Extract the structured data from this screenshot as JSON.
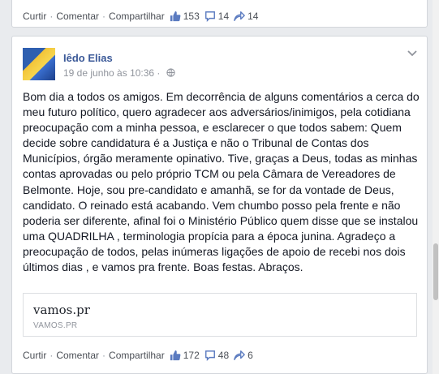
{
  "top_post": {
    "actions": {
      "curtir": "Curtir",
      "comentar": "Comentar",
      "compartilhar": "Compartilhar"
    },
    "counts": {
      "likes": "153",
      "comments": "14",
      "shares": "14"
    }
  },
  "post": {
    "author": "Iêdo Elias",
    "timestamp": "19 de junho às 10:36 ·",
    "body": "Bom dia a todos os amigos. Em decorrência de alguns comentários a cerca do meu futuro político, quero agradecer aos adversários/inimigos, pela cotidiana preocupação com a minha pessoa, e esclarecer o que todos sabem: Quem decide sobre candidatura é a Justiça e não o Tribunal de Contas dos Municípios, órgão meramente opinativo. Tive, graças a Deus, todas as minhas contas aprovadas ou pelo próprio TCM ou pela Câmara de Vereadores de Belmonte. Hoje, sou pre-candidato e amanhã, se for da vontade de Deus, candidato. O reinado está acabando. Vem chumbo posso pela frente e não poderia ser diferente, afinal foi o Ministério Público quem disse que se instalou uma QUADRILHA , terminologia propícia para a época junina. Agradeço a preocupação de todos, pelas inúmeras ligações de apoio de recebi nos dois últimos dias , e vamos pra frente. Boas festas. Abraços.",
    "link": {
      "title": "vamos.pr",
      "domain": "VAMOS.PR"
    },
    "actions": {
      "curtir": "Curtir",
      "comentar": "Comentar",
      "compartilhar": "Compartilhar"
    },
    "counts": {
      "likes": "172",
      "comments": "48",
      "shares": "6"
    }
  },
  "colors": {
    "link_blue": "#3b5998",
    "icon_blue": "#5b7bc0",
    "meta_gray": "#90949c"
  },
  "icons": [
    "thumbs-up-icon",
    "comment-icon",
    "share-icon",
    "globe-icon",
    "chevron-down-icon"
  ]
}
